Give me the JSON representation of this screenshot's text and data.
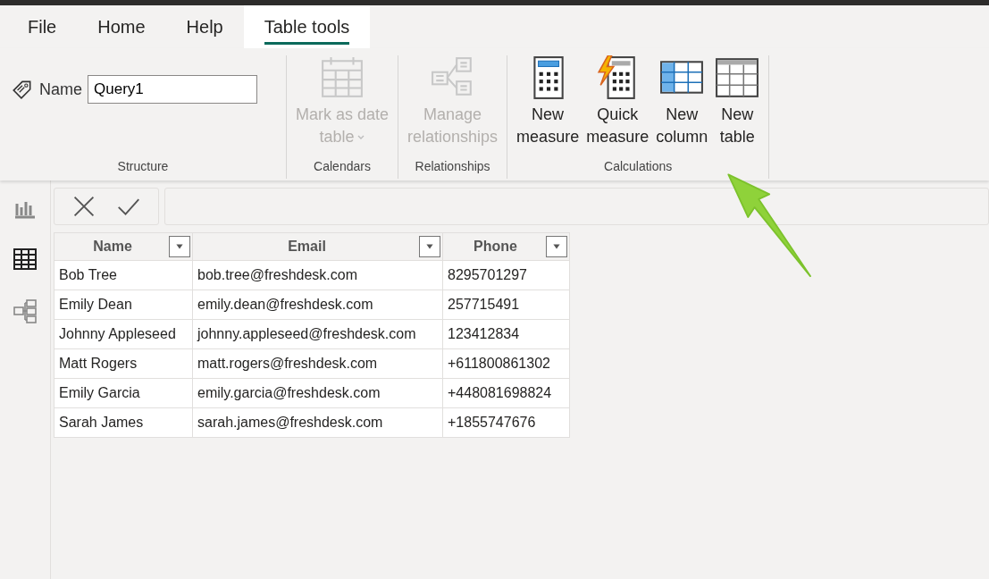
{
  "tabs": [
    {
      "label": "File",
      "selected": false
    },
    {
      "label": "Home",
      "selected": false
    },
    {
      "label": "Help",
      "selected": false
    },
    {
      "label": "Table tools",
      "selected": true
    }
  ],
  "ribbon": {
    "name_field": {
      "label": "Name",
      "value": "Query1"
    },
    "groups": [
      {
        "label": "Structure"
      },
      {
        "label": "Calendars",
        "buttons": [
          {
            "kind": "date-table",
            "lines": [
              "Mark as date",
              "table"
            ],
            "disabled": true,
            "dropdown": true
          }
        ]
      },
      {
        "label": "Relationships",
        "buttons": [
          {
            "kind": "relationships",
            "lines": [
              "Manage",
              "relationships"
            ],
            "disabled": true,
            "dropdown": false
          }
        ]
      },
      {
        "label": "Calculations",
        "buttons": [
          {
            "kind": "measure",
            "lines": [
              "New",
              "measure"
            ],
            "disabled": false,
            "dropdown": false
          },
          {
            "kind": "quick-measure",
            "lines": [
              "Quick",
              "measure"
            ],
            "disabled": false,
            "dropdown": false
          },
          {
            "kind": "column",
            "lines": [
              "New",
              "column"
            ],
            "disabled": false,
            "dropdown": false
          },
          {
            "kind": "table",
            "lines": [
              "New",
              "table"
            ],
            "disabled": false,
            "dropdown": false
          }
        ]
      }
    ]
  },
  "sidebar": {
    "items": [
      {
        "kind": "report",
        "selected": false
      },
      {
        "kind": "data",
        "selected": true
      },
      {
        "kind": "model",
        "selected": false
      }
    ]
  },
  "table": {
    "columns": [
      "Name",
      "Email",
      "Phone"
    ],
    "rows": [
      [
        "Bob Tree",
        "bob.tree@freshdesk.com",
        "8295701297"
      ],
      [
        "Emily Dean",
        "emily.dean@freshdesk.com",
        "257715491"
      ],
      [
        "Johnny Appleseed",
        "johnny.appleseed@freshdesk.com",
        "123412834"
      ],
      [
        "Matt Rogers",
        "matt.rogers@freshdesk.com",
        "+611800861302"
      ],
      [
        "Emily Garcia",
        "emily.garcia@freshdesk.com",
        "+448081698824"
      ],
      [
        "Sarah James",
        "sarah.james@freshdesk.com",
        "+1855747676"
      ]
    ]
  }
}
